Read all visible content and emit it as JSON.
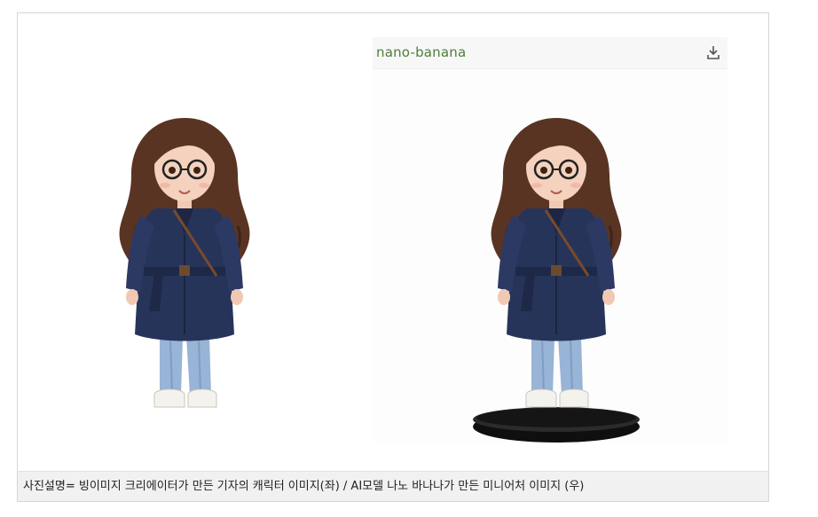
{
  "right_panel": {
    "title": "nano-banana",
    "download_icon": "download-icon"
  },
  "figures": {
    "left": "character-figure-illustration",
    "right": "miniature-figure-on-stand"
  },
  "colors": {
    "coat": "#27345a",
    "hair": "#5a3423",
    "jeans": "#98b4d6",
    "title_green": "#4e7d3a",
    "base": "#0f0f10"
  },
  "caption": "사진설명= 빙이미지 크리에이터가 만든 기자의 캐릭터 이미지(좌) / AI모델 나노 바나나가 만든 미니어처 이미지 (우)"
}
